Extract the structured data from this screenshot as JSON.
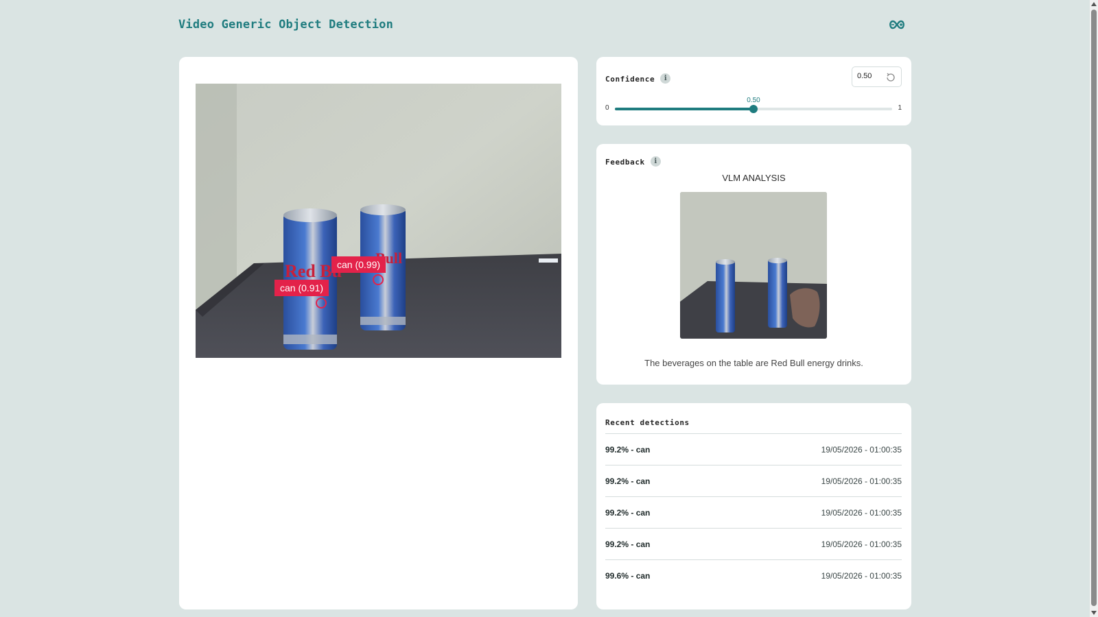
{
  "header": {
    "title": "Video Generic Object Detection",
    "logo_icon": "infinity-logo-icon"
  },
  "video": {
    "detections": [
      {
        "label": "can (0.99)"
      },
      {
        "label": "can (0.91)"
      }
    ]
  },
  "confidence": {
    "title": "Confidence",
    "value": "0.50",
    "value_fraction": 0.5,
    "min": "0",
    "max": "1",
    "bubble": "0.50"
  },
  "feedback": {
    "title": "Feedback",
    "vlm_title": "VLM ANALYSIS",
    "vlm_text": "The beverages on the table are Red Bull energy drinks."
  },
  "recent": {
    "title": "Recent detections",
    "rows": [
      {
        "text": "99.2% - can",
        "time": "19/05/2026 - 01:00:35"
      },
      {
        "text": "99.2% - can",
        "time": "19/05/2026 - 01:00:35"
      },
      {
        "text": "99.2% - can",
        "time": "19/05/2026 - 01:00:35"
      },
      {
        "text": "99.2% - can",
        "time": "19/05/2026 - 01:00:35"
      },
      {
        "text": "99.6% - can",
        "time": "19/05/2026 - 01:00:35"
      }
    ]
  },
  "colors": {
    "accent": "#1f7c7f",
    "background": "#dae4e3",
    "detection": "#e3224a"
  }
}
